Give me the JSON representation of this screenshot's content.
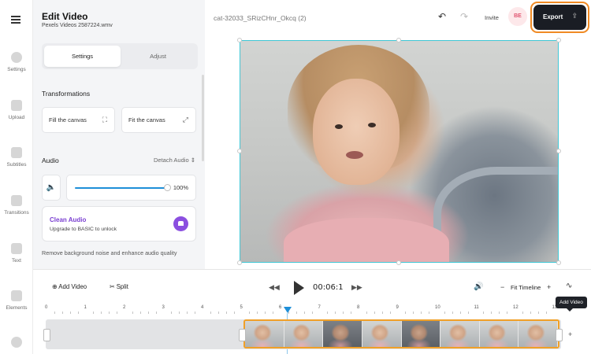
{
  "rail": {
    "items": [
      {
        "label": "Settings",
        "icon": "gear-icon"
      },
      {
        "label": "Upload",
        "icon": "plus-icon"
      },
      {
        "label": "Subtitles",
        "icon": "subtitles-icon"
      },
      {
        "label": "Transitions",
        "icon": "transitions-icon"
      },
      {
        "label": "Text",
        "icon": "text-icon"
      },
      {
        "label": "Elements",
        "icon": "elements-icon"
      }
    ]
  },
  "panel": {
    "title": "Edit Video",
    "subtitle": "Pexels Videos 2587224.wmv",
    "tabs": {
      "settings": "Settings",
      "adjust": "Adjust"
    },
    "transformations_label": "Transformations",
    "fill_canvas_label": "Fill the canvas",
    "fit_canvas_label": "Fit the canvas",
    "audio_label": "Audio",
    "detach_audio_label": "Detach Audio",
    "volume_value": "100%",
    "volume_level": 1.0,
    "clean_audio_title": "Clean Audio",
    "clean_audio_sub": "Upgrade to BASIC to unlock",
    "note": "Remove background noise and enhance audio quality"
  },
  "header": {
    "file_name": "cat-32033_SRizCHnr_Okcq (2)",
    "invite_label": "Invite",
    "avatar_initials": "BE",
    "export_label": "Export"
  },
  "toolbar": {
    "add_video_label": "Add Video",
    "split_label": "Split",
    "time": "00:06:1",
    "fit_timeline_label": "Fit Timeline",
    "tooltip": "Add Video"
  },
  "timeline": {
    "ticks": [
      "0",
      "1",
      "2",
      "3",
      "4",
      "5",
      "6",
      "7",
      "8",
      "9",
      "10",
      "11",
      "12",
      "13"
    ]
  },
  "colors": {
    "accent": "#1e8fd8",
    "export_outline": "#f08a24",
    "clip_border": "#f0a028",
    "clean_audio": "#7a3fd1"
  }
}
